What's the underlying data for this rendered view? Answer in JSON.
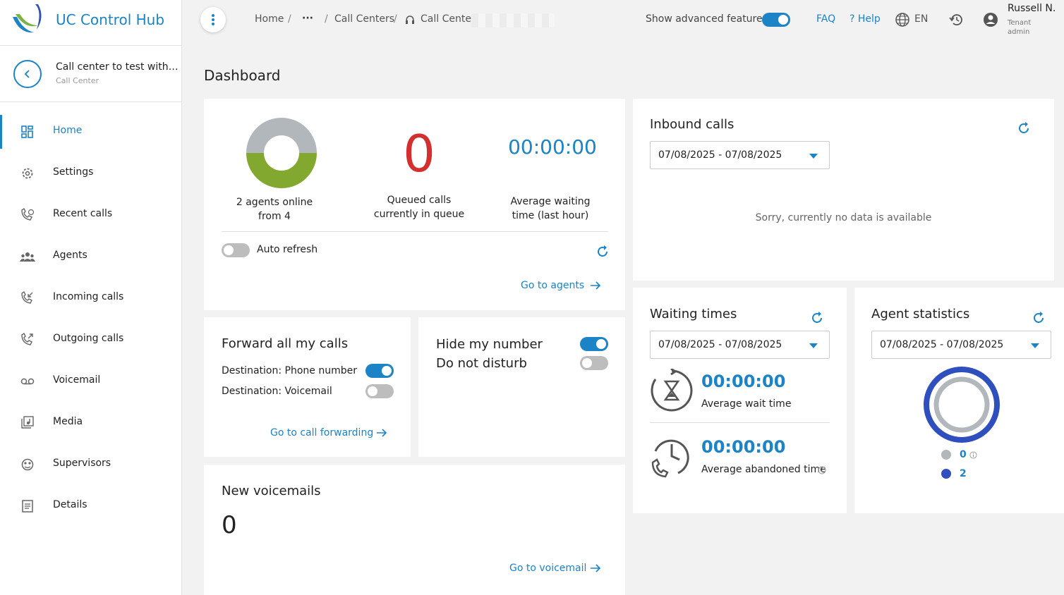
{
  "app": {
    "title": "UC Control Hub",
    "brand_color": "#1b83c6"
  },
  "sidebar": {
    "back_label": "Call center to test with st...",
    "subtitle": "Call Center",
    "items": [
      {
        "label": "Home",
        "icon": "dashboard-icon",
        "active": true
      },
      {
        "label": "Settings",
        "icon": "gear-icon"
      },
      {
        "label": "Recent calls",
        "icon": "phone-history-icon"
      },
      {
        "label": "Agents",
        "icon": "people-icon"
      },
      {
        "label": "Incoming calls",
        "icon": "phone-incoming-icon"
      },
      {
        "label": "Outgoing calls",
        "icon": "phone-outgoing-icon"
      },
      {
        "label": "Voicemail",
        "icon": "voicemail-icon"
      },
      {
        "label": "Media",
        "icon": "media-icon"
      },
      {
        "label": "Supervisors",
        "icon": "supervisor-icon"
      },
      {
        "label": "Details",
        "icon": "details-icon"
      }
    ]
  },
  "topbar": {
    "breadcrumb": {
      "home": "Home",
      "ellipsis": "···",
      "call_centers": "Call Centers",
      "current": "Call Center"
    },
    "advanced_label": "Show advanced features",
    "advanced_on": true,
    "faq": "FAQ",
    "help": "? Help",
    "language": "EN",
    "user": {
      "name": "Russell N.",
      "role_line1": "Tenant",
      "role_line2": "admin"
    }
  },
  "page_title": "Dashboard",
  "overview": {
    "agents_online_line1": "2 agents online",
    "agents_online_line2": "from 4",
    "agents_online": 2,
    "agents_total": 4,
    "queued_value": "0",
    "queued_line1": "Queued calls",
    "queued_line2": "currently in queue",
    "avg_wait_value": "00:00:00",
    "avg_wait_line1": "Average waiting",
    "avg_wait_line2": "time (last hour)",
    "auto_refresh_label": "Auto refresh",
    "auto_refresh_on": false,
    "go_agents": "Go to agents",
    "colors": {
      "online": "#82a830",
      "offline": "#b2b7bb",
      "queued": "#d32f2f"
    }
  },
  "forwarding": {
    "title": "Forward all my calls",
    "dest_phone": "Destination: Phone number",
    "dest_phone_on": true,
    "dest_voicemail": "Destination: Voicemail",
    "dest_voicemail_on": false,
    "go_forwarding": "Go to call forwarding"
  },
  "privacy": {
    "hide_number": "Hide my number",
    "hide_number_on": true,
    "dnd": "Do not disturb",
    "dnd_on": false
  },
  "voicemails": {
    "title": "New voicemails",
    "count": "0",
    "go_voicemail": "Go to voicemail"
  },
  "inbound": {
    "title": "Inbound calls",
    "date_range": "07/08/2025 - 07/08/2025",
    "empty": "Sorry, currently no data is available"
  },
  "waiting": {
    "title": "Waiting times",
    "date_range": "07/08/2025 - 07/08/2025",
    "avg_wait_value": "00:00:00",
    "avg_wait_label": "Average wait time",
    "avg_abandon_value": "00:00:00",
    "avg_abandon_label": "Average abandoned time"
  },
  "agent_stats": {
    "title": "Agent statistics",
    "date_range": "07/08/2025 - 07/08/2025",
    "legend": [
      {
        "value": "0",
        "color": "#b2b7bb"
      },
      {
        "value": "2",
        "color": "#2e4fbd"
      }
    ]
  }
}
